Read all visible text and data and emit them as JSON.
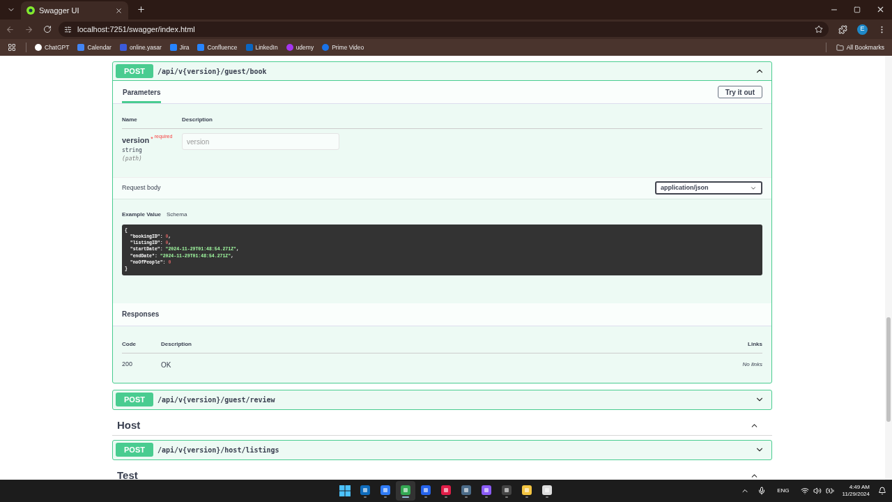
{
  "browser": {
    "tab": "Swagger UI",
    "url": "localhost:7251/swagger/index.html",
    "profile": "E",
    "all_bookmarks": "All Bookmarks",
    "bookmarks": [
      {
        "label": "ChatGPT",
        "kind": "chatgpt"
      },
      {
        "label": "Calendar",
        "kind": "calendar"
      },
      {
        "label": "online.yasar",
        "kind": "shield"
      },
      {
        "label": "Jira",
        "kind": "jira"
      },
      {
        "label": "Confluence",
        "kind": "confluence"
      },
      {
        "label": "LinkedIn",
        "kind": "linkedin"
      },
      {
        "label": "udemy",
        "kind": "udemy"
      },
      {
        "label": "Prime Video",
        "kind": "play"
      }
    ]
  },
  "operations": [
    {
      "method": "POST",
      "path": "/api/v{version}/guest/book",
      "expanded": true,
      "details": {
        "tabs": [
          {
            "label": "Parameters",
            "selected": true
          }
        ],
        "try_button": "Try it out",
        "columns": [
          "Name",
          "Description"
        ],
        "parameters": [
          {
            "name": "version",
            "star": "*",
            "required": "required",
            "type": "string",
            "location": "(path)",
            "placeholder": "version"
          }
        ],
        "request_body": {
          "label": "Request body",
          "content_type": "application/json",
          "tabs": [
            {
              "label": "Example Value",
              "selected": true
            },
            {
              "label": "Schema",
              "selected": false
            }
          ],
          "lines": [
            [
              {
                "text": "{",
                "kind": "punct"
              }
            ],
            [
              {
                "text": "  \"bookingID\"",
                "kind": "key"
              },
              {
                "text": ": ",
                "kind": "punct"
              },
              {
                "text": "0",
                "kind": "number"
              },
              {
                "text": ",",
                "kind": "punct"
              }
            ],
            [
              {
                "text": "  \"listingID\"",
                "kind": "key"
              },
              {
                "text": ": ",
                "kind": "punct"
              },
              {
                "text": "0",
                "kind": "number"
              },
              {
                "text": ",",
                "kind": "punct"
              }
            ],
            [
              {
                "text": "  \"startDate\"",
                "kind": "key"
              },
              {
                "text": ": ",
                "kind": "punct"
              },
              {
                "text": "\"2024-11-29T01:48:54.271Z\"",
                "kind": "string"
              },
              {
                "text": ",",
                "kind": "punct"
              }
            ],
            [
              {
                "text": "  \"endDate\"",
                "kind": "key"
              },
              {
                "text": ": ",
                "kind": "punct"
              },
              {
                "text": "\"2024-11-29T01:48:54.271Z\"",
                "kind": "string"
              },
              {
                "text": ",",
                "kind": "punct"
              }
            ],
            [
              {
                "text": "  \"noOfPeople\"",
                "kind": "key"
              },
              {
                "text": ": ",
                "kind": "punct"
              },
              {
                "text": "0",
                "kind": "number"
              }
            ],
            [
              {
                "text": "}",
                "kind": "punct"
              }
            ]
          ]
        },
        "responses": {
          "title": "Responses",
          "columns": [
            "Code",
            "Description",
            "Links"
          ],
          "rows": [
            {
              "code": "200",
              "description": "OK",
              "links": "No links"
            }
          ]
        }
      }
    },
    {
      "method": "POST",
      "path": "/api/v{version}/guest/review",
      "expanded": false
    }
  ],
  "sections": [
    {
      "title": "Host",
      "expanded": true,
      "operations": [
        {
          "method": "POST",
          "path": "/api/v{version}/host/listings",
          "expanded": false
        }
      ]
    },
    {
      "title": "Test",
      "expanded": true
    }
  ],
  "taskbar": {
    "apps": [
      {
        "kind": "outlook",
        "active": false
      },
      {
        "kind": "todo",
        "active": false
      },
      {
        "kind": "chrome",
        "active": true
      },
      {
        "kind": "ide-blue",
        "active": false
      },
      {
        "kind": "ide-red",
        "active": false
      },
      {
        "kind": "db",
        "active": false
      },
      {
        "kind": "studio",
        "active": false
      },
      {
        "kind": "terminal",
        "active": false
      },
      {
        "kind": "folder",
        "active": false
      },
      {
        "kind": "recorder",
        "active": false
      }
    ],
    "language": "ENG",
    "time": "4:49 AM",
    "date": "11/29/2024"
  }
}
